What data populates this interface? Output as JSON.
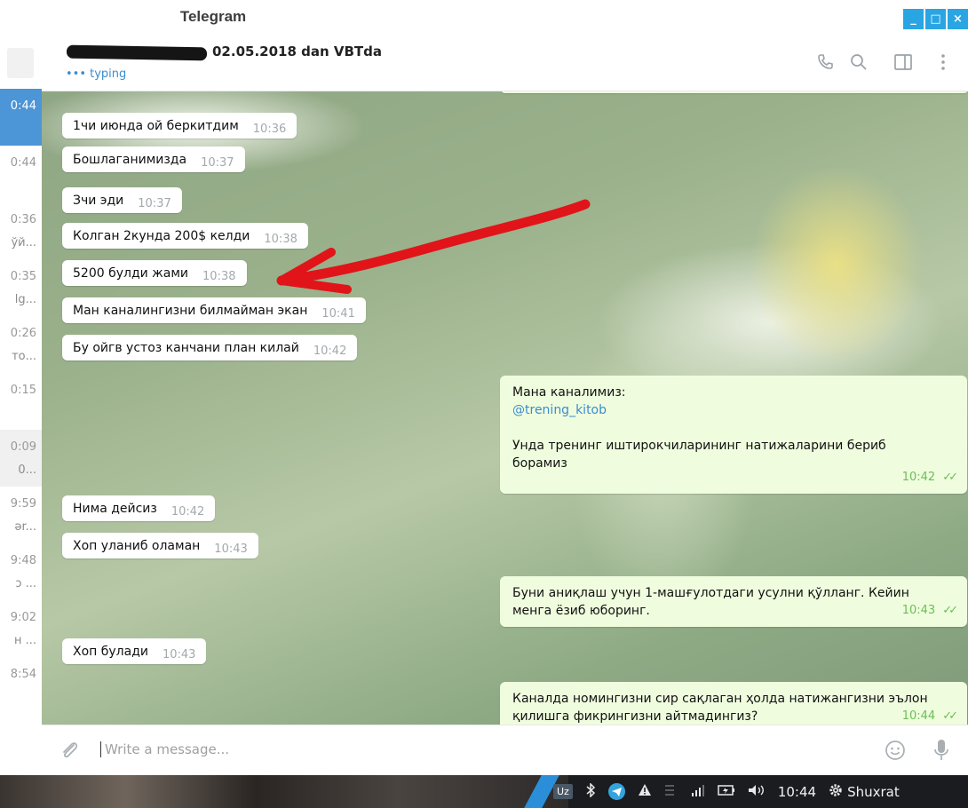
{
  "window": {
    "title": "Telegram",
    "buttons": [
      "_",
      "□",
      "×"
    ]
  },
  "sidebar": {
    "items": [
      {
        "time": "0:44",
        "snippet": "",
        "active": true
      },
      {
        "time": "0:44",
        "snippet": ""
      },
      {
        "time": "0:36",
        "snippet": "ўй..."
      },
      {
        "time": "0:35",
        "snippet": "lg..."
      },
      {
        "time": "0:26",
        "snippet": "то..."
      },
      {
        "time": "0:15",
        "snippet": ""
      },
      {
        "time": "0:09",
        "snippet": "0...",
        "hover": true
      },
      {
        "time": "9:59",
        "snippet": "ər..."
      },
      {
        "time": "9:48",
        "snippet": "ɔ ..."
      },
      {
        "time": "9:02",
        "snippet": "н ..."
      },
      {
        "time": "8:54",
        "snippet": ""
      }
    ]
  },
  "header": {
    "chat_name": "02.05.2018 dan VBTda",
    "status": "••• typing",
    "icons": [
      "phone-icon",
      "search-icon",
      "sidebar-toggle-icon",
      "more-icon"
    ]
  },
  "messages": {
    "incoming": [
      {
        "text": "1чи июнда  ой беркитдим",
        "time": "10:36"
      },
      {
        "text": "Бошлаганимизда",
        "time": "10:37"
      },
      {
        "text": "Зчи эди",
        "time": "10:37"
      },
      {
        "text": "Колган 2кунда 200$ келди",
        "time": "10:38"
      },
      {
        "text": "5200 булди жами",
        "time": "10:38"
      },
      {
        "text": "Ман каналингизни билмайман экан",
        "time": "10:41"
      },
      {
        "text": "Бу ойгв устоз канчани план килай",
        "time": "10:42"
      },
      {
        "text": "Нима дейсиз",
        "time": "10:42"
      },
      {
        "text": "Хоп уланиб оламан",
        "time": "10:43"
      },
      {
        "text": "Хоп булади",
        "time": "10:43"
      }
    ],
    "outgoing": [
      {
        "line1": "Мана каналимиз:",
        "link": "@trening_kitob",
        "line3": "Унда тренинг иштирокчиларининг натижаларини бериб",
        "line4": "борамиз",
        "time": "10:42",
        "ticks": "✓✓"
      },
      {
        "line1": "Буни аниқлаш учун 1-машғулотдаги усулни қўлланг. Кейин",
        "line2": "менга ёзиб юборинг.",
        "time": "10:43",
        "ticks": "✓✓"
      },
      {
        "line1": "Каналда номингизни сир сақлаган ҳолда натижангизни эълон",
        "line2": "қилишга фикрингизни айтмадингиз?",
        "time": "10:44",
        "ticks": "✓✓"
      }
    ]
  },
  "composer": {
    "placeholder": "Write a message...",
    "icons": [
      "attach-icon",
      "emoji-icon",
      "microphone-icon"
    ]
  },
  "taskbar": {
    "language": "Uz",
    "clock": "10:44",
    "user": "Shuxrat"
  },
  "colors": {
    "accent": "#2aa5e3",
    "link": "#3a8cd0",
    "outgoing_bubble": "#effdde",
    "arrow": "#e1141a"
  }
}
